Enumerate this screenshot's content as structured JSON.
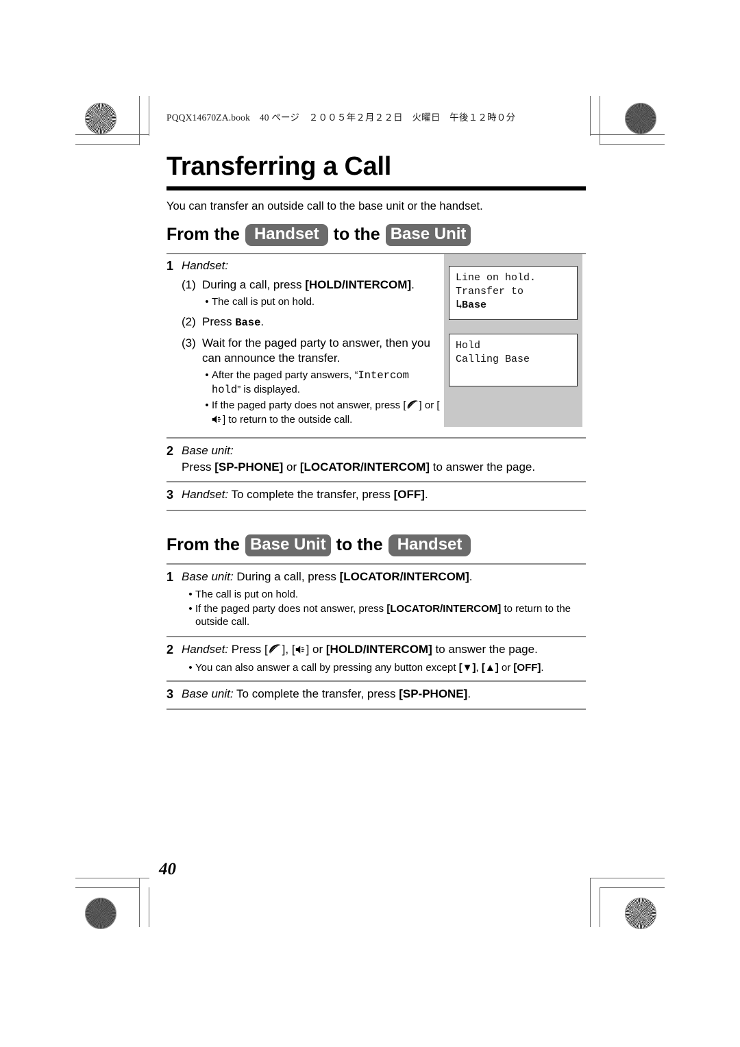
{
  "book_header": "PQQX14670ZA.book　40 ページ　２００５年２月２２日　火曜日　午後１２時０分",
  "title": "Transferring a Call",
  "intro": "You can transfer an outside call to the base unit or the handset.",
  "page_number": "40",
  "colors": {
    "badge_bg": "#6b6b6b",
    "panel_bg": "#c8c8c8",
    "rule": "#8c8c8c",
    "title_rule": "#000000"
  },
  "section1": {
    "head_prefix": "From the",
    "badge_a": "Handset",
    "head_middle": "to the",
    "badge_b": "Base Unit",
    "steps": [
      {
        "num": "1",
        "label": "Handset:",
        "substeps": [
          {
            "num": "(1)",
            "text_a": "During a call, press ",
            "key": "[HOLD/INTERCOM]",
            "text_b": ".",
            "bullets": [
              {
                "text": "The call is put on hold."
              }
            ]
          },
          {
            "num": "(2)",
            "text_a": "Press ",
            "mono": "Base",
            "text_b": ".",
            "bullets": []
          },
          {
            "num": "(3)",
            "text_a": "Wait for the paged party to answer, then you can announce the transfer.",
            "bullets": [
              {
                "pre": "After the paged party answers, “",
                "mono": "Intercom hold",
                "post": "” is displayed."
              },
              {
                "pre": "If the paged party does not answer, press [",
                "icon1": "phone-talk-icon",
                "mid": "] or [",
                "icon2": "speakerphone-icon",
                "post": "] to return to the outside call."
              }
            ]
          }
        ]
      },
      {
        "num": "2",
        "label": "Base unit:",
        "line_a": "Press ",
        "key_a": "[SP-PHONE]",
        "line_b": " or ",
        "key_b": "[LOCATOR/INTERCOM]",
        "line_c": " to answer the page."
      },
      {
        "num": "3",
        "label": "Handset:",
        "line_a": " To complete the transfer, press ",
        "key_a": "[OFF]",
        "line_b": "."
      }
    ],
    "lcd_screens": [
      {
        "name": "lcd-line-on-hold",
        "lines": [
          {
            "text": "Line on hold.",
            "bold": false,
            "arrow": false
          },
          {
            "text": "Transfer to",
            "bold": false,
            "arrow": false
          },
          {
            "text": "Base",
            "bold": true,
            "arrow": true
          }
        ]
      },
      {
        "name": "lcd-hold-calling-base",
        "lines": [
          {
            "text": "Hold",
            "bold": false,
            "arrow": false
          },
          {
            "text": "Calling Base",
            "bold": false,
            "arrow": false
          },
          {
            "text": "",
            "bold": false,
            "arrow": false
          }
        ]
      }
    ]
  },
  "section2": {
    "head_prefix": "From the",
    "badge_a": "Base Unit",
    "head_middle": "to the",
    "badge_b": "Handset",
    "steps": [
      {
        "num": "1",
        "label": "Base unit:",
        "line_a": " During a call, press ",
        "key_a": "[LOCATOR/INTERCOM]",
        "line_b": ".",
        "bullets": [
          {
            "text": "The call is put on hold."
          },
          {
            "pre": "If the paged party does not answer, press ",
            "key": "[LOCATOR/INTERCOM]",
            "post": " to return to the outside call."
          }
        ]
      },
      {
        "num": "2",
        "label": "Handset:",
        "line_a": " Press [",
        "icon1": "phone-talk-icon",
        "line_b": "], [",
        "icon2": "speakerphone-icon",
        "line_c": "] or ",
        "key_a": "[HOLD/INTERCOM]",
        "line_d": " to answer the page.",
        "bullets": [
          {
            "pre": "You can also answer a call by pressing any button except ",
            "key_a": "[▼]",
            "mid_a": ", ",
            "key_b": "[▲]",
            "mid_b": " or ",
            "key_c": "[OFF]",
            "post": "."
          }
        ]
      },
      {
        "num": "3",
        "label": "Base unit:",
        "line_a": " To complete the transfer, press ",
        "key_a": "[SP-PHONE]",
        "line_b": "."
      }
    ]
  }
}
